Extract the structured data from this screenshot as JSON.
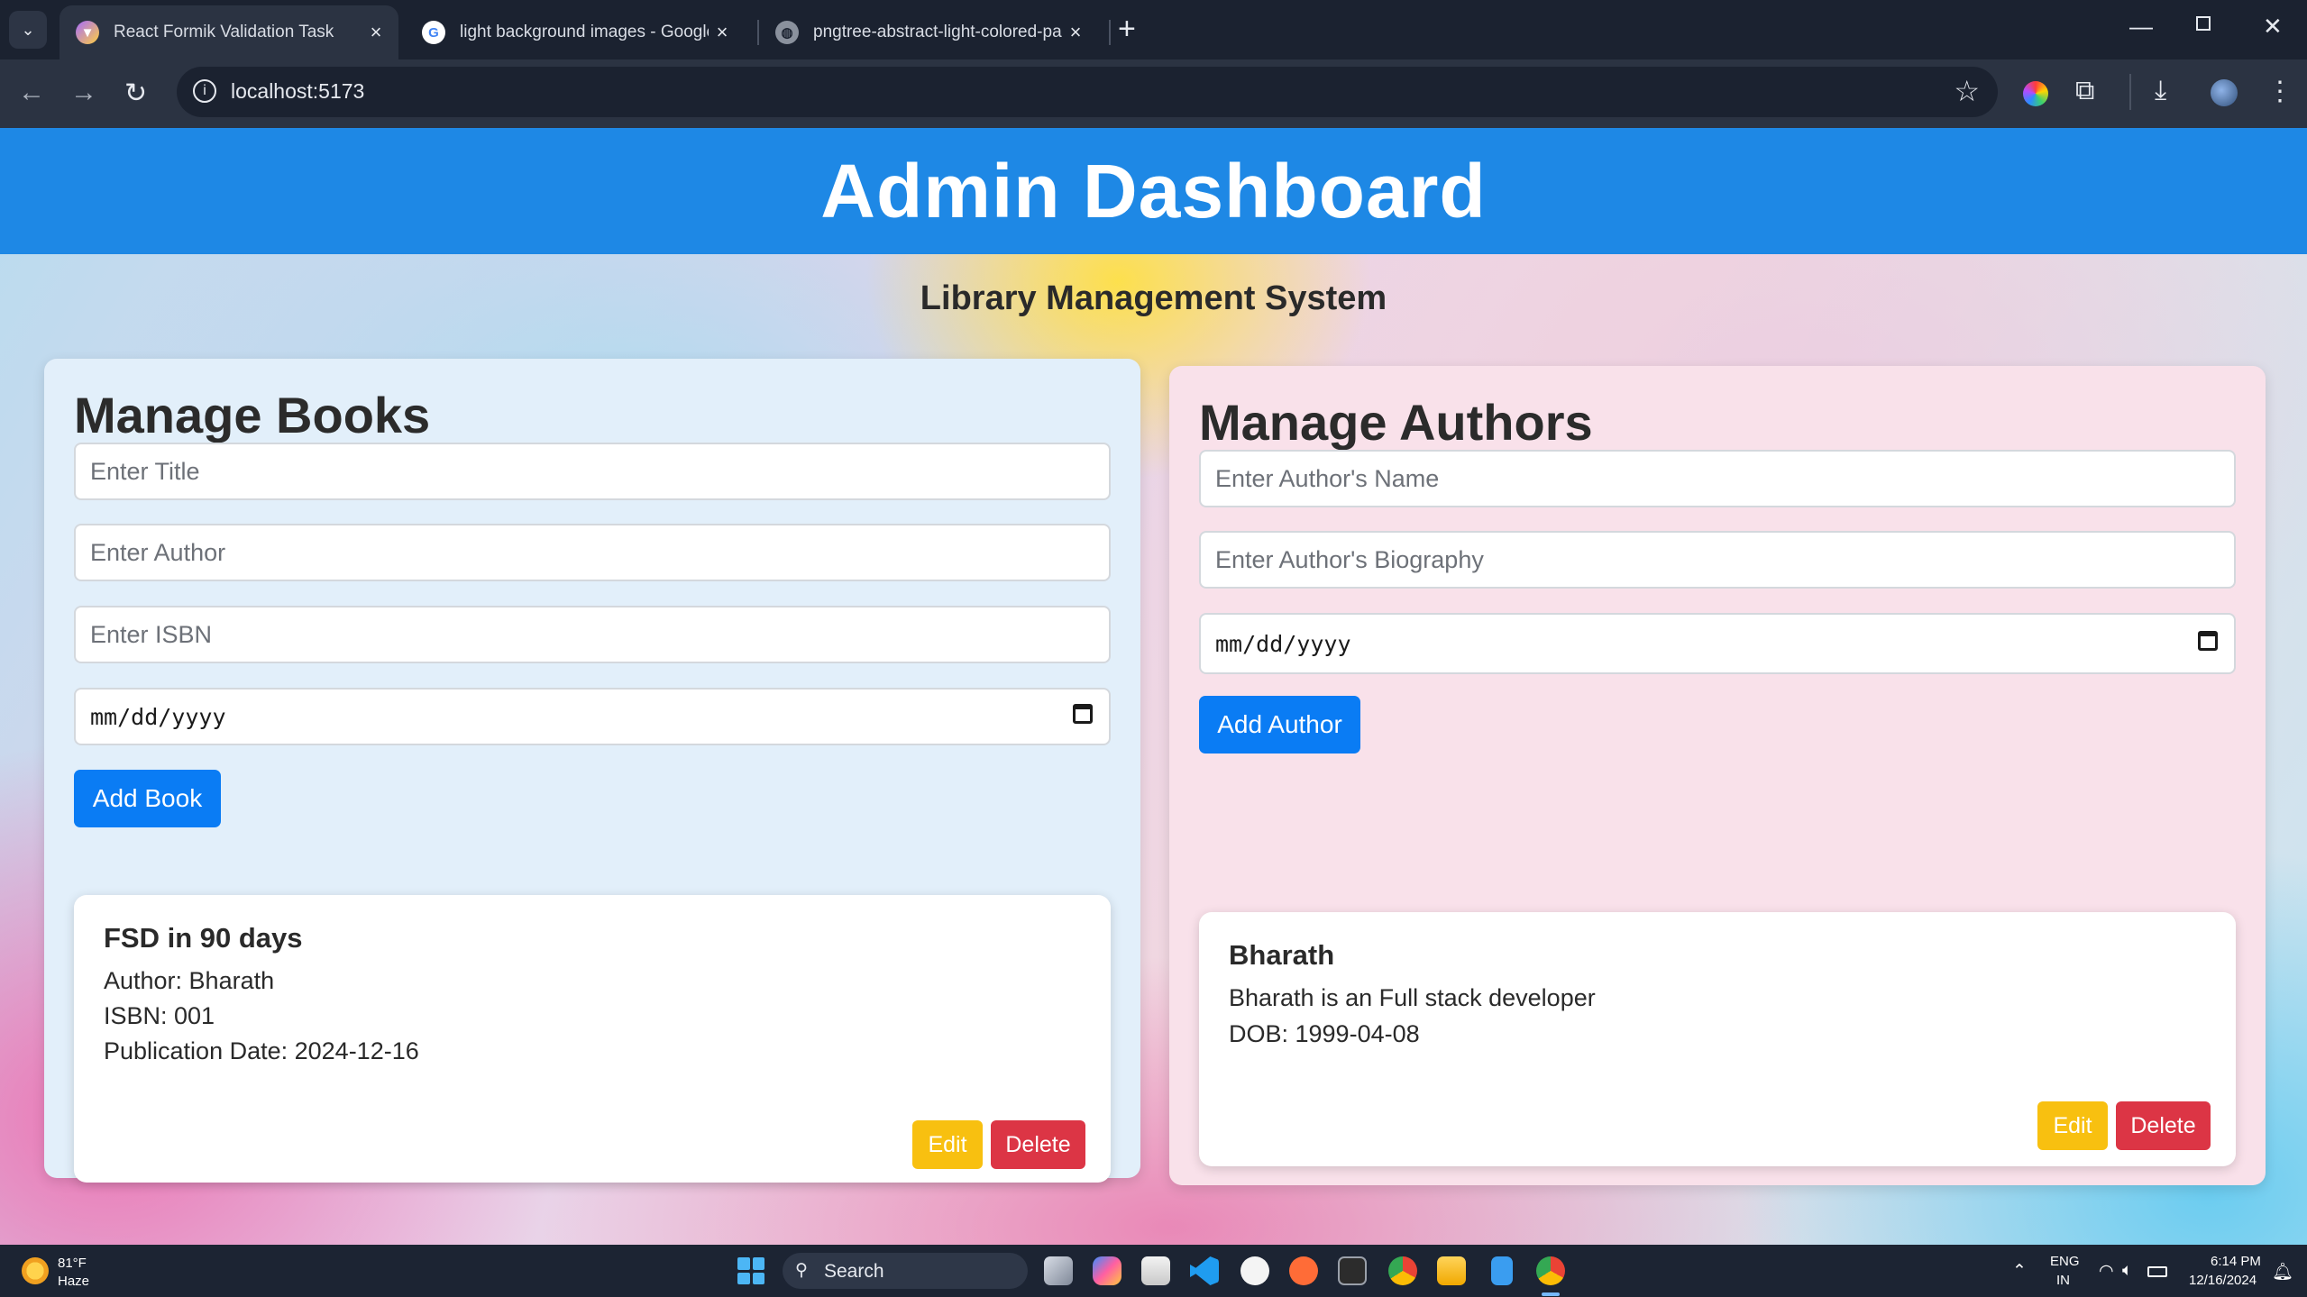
{
  "browser": {
    "tabs": [
      {
        "title": "React Formik Validation Task",
        "active": true
      },
      {
        "title": "light background images - Google",
        "active": false
      },
      {
        "title": "pngtree-abstract-light-colored-pa",
        "active": false
      }
    ],
    "url": "localhost:5173"
  },
  "header": {
    "title": "Admin Dashboard"
  },
  "subtitle": "Library Management System",
  "books": {
    "heading": "Manage Books",
    "title_placeholder": "Enter Title",
    "author_placeholder": "Enter Author",
    "isbn_placeholder": "Enter ISBN",
    "date_placeholder": "mm/dd/yyyy",
    "add_label": "Add Book",
    "card": {
      "title": "FSD in 90 days",
      "author": "Author: Bharath",
      "isbn": "ISBN: 001",
      "date": "Publication Date: 2024-12-16",
      "edit_label": "Edit",
      "delete_label": "Delete"
    }
  },
  "authors": {
    "heading": "Manage Authors",
    "name_placeholder": "Enter Author's Name",
    "bio_placeholder": "Enter Author's Biography",
    "date_placeholder": "mm/dd/yyyy",
    "add_label": "Add Author",
    "card": {
      "name": "Bharath",
      "bio": "Bharath is an Full stack developer",
      "dob": "DOB: 1999-04-08",
      "edit_label": "Edit",
      "delete_label": "Delete"
    }
  },
  "taskbar": {
    "weather_temp": "81°F",
    "weather_cond": "Haze",
    "search_label": "Search",
    "lang_line1": "ENG",
    "lang_line2": "IN",
    "time": "6:14 PM",
    "date": "12/16/2024"
  },
  "colors": {
    "header_bg": "#1e88e5",
    "primary_button": "#0a7cf4",
    "edit_button": "#f8c010",
    "delete_button": "#dc3545",
    "books_panel": "#e2effa",
    "authors_panel": "#f9e1ea"
  }
}
